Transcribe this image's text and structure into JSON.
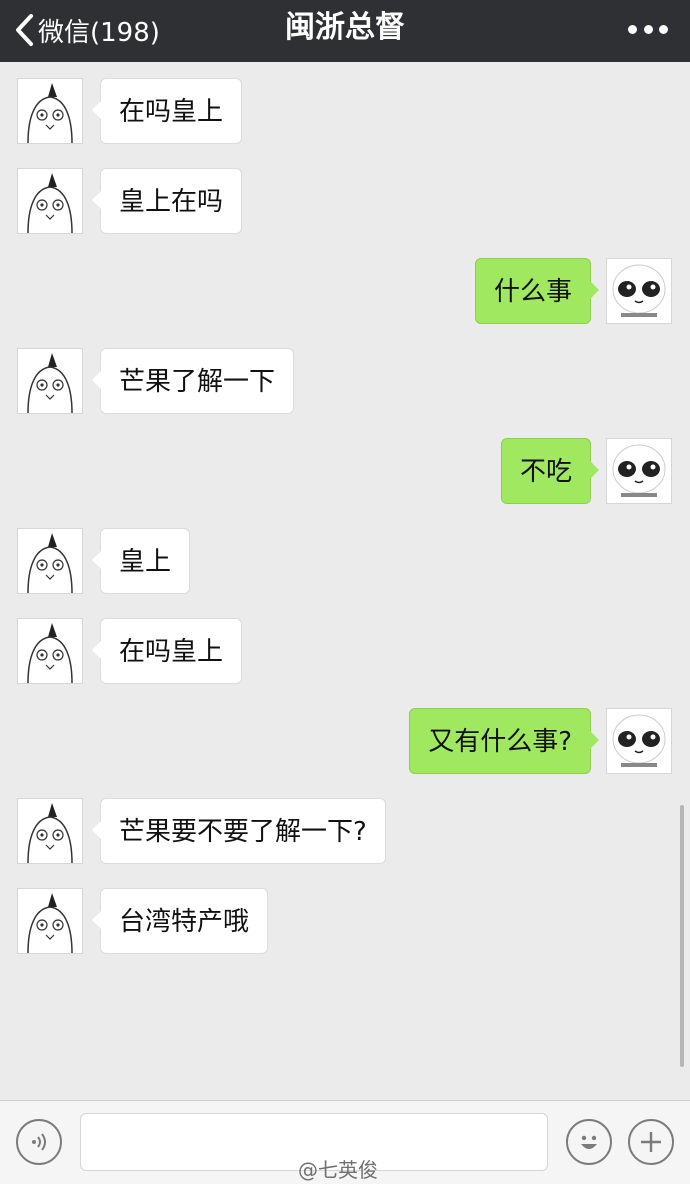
{
  "header": {
    "back_label": "微信(198)",
    "title": "闽浙总督"
  },
  "messages": [
    {
      "side": "left",
      "text": "在吗皇上"
    },
    {
      "side": "left",
      "text": "皇上在吗"
    },
    {
      "side": "right",
      "text": "什么事"
    },
    {
      "side": "left",
      "text": "芒果了解一下"
    },
    {
      "side": "right",
      "text": "不吃"
    },
    {
      "side": "left",
      "text": "皇上"
    },
    {
      "side": "left",
      "text": "在吗皇上"
    },
    {
      "side": "right",
      "text": "又有什么事?"
    },
    {
      "side": "left",
      "text": "芒果要不要了解一下?"
    },
    {
      "side": "left",
      "text": "台湾特产哦"
    }
  ],
  "input": {
    "value": "",
    "placeholder": ""
  },
  "watermark": "@七英俊",
  "colors": {
    "header_bg": "#2e3033",
    "chat_bg": "#ebebeb",
    "sent_bubble": "#9fe85f",
    "received_bubble": "#ffffff"
  },
  "icons": [
    "back-chevron-icon",
    "more-dots-icon",
    "voice-icon",
    "emoji-icon",
    "plus-icon"
  ]
}
